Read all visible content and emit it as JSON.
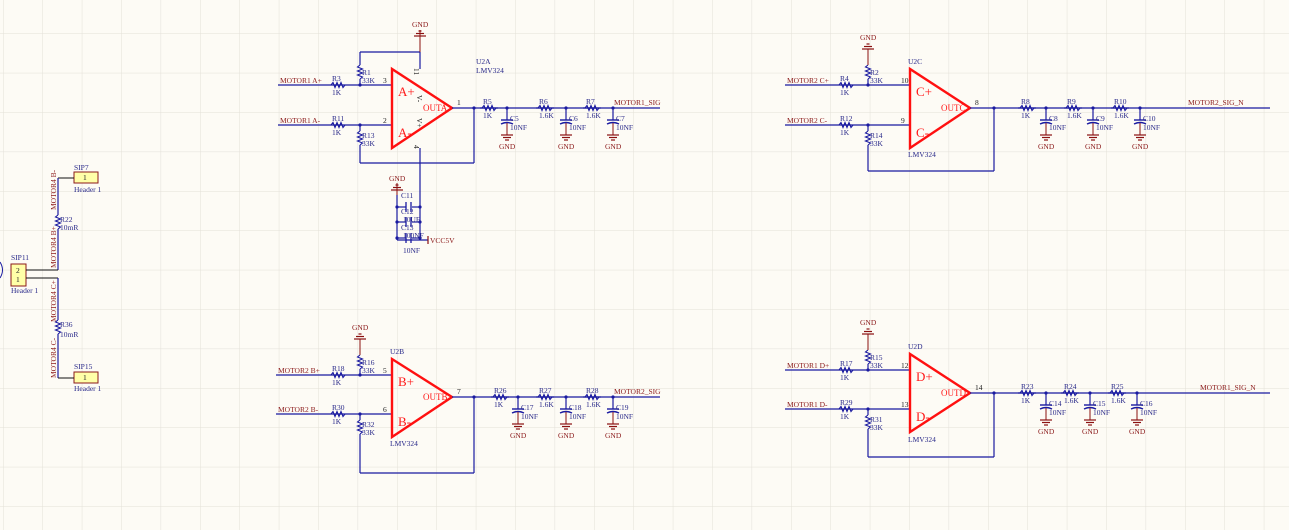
{
  "colors": {
    "wire": "#1a1aa0",
    "opamp": "#ff1010",
    "net_label": "#8b1a1a",
    "ref_text": "#2a2a8a",
    "ground": "#8b1010",
    "grid": "#e3e0d8",
    "background": "#fdfbf5",
    "header_fill": "#ffffa8"
  },
  "gnd_label": "GND",
  "blocks": [
    {
      "unit": "U2A",
      "part": "LMV324",
      "in_pos_net": "MOTOR1 A+",
      "in_neg_net": "MOTOR1 A-",
      "r_in_pos": {
        "ref": "R3",
        "value": "1K"
      },
      "r_bias": {
        "ref": "R1",
        "value": "33K"
      },
      "r_in_neg": {
        "ref": "R11",
        "value": "1K"
      },
      "r_fb": {
        "ref": "R13",
        "value": "33K"
      },
      "pin_pos": "3",
      "pin_neg": "2",
      "pin_out": "1",
      "sym_pos": "A+",
      "sym_neg": "A-",
      "sym_out": "OUTA",
      "filter": [
        {
          "r": "R5",
          "rv": "1K",
          "c": "C5",
          "cv": "10NF"
        },
        {
          "r": "R6",
          "rv": "1.6K",
          "c": "C6",
          "cv": "10NF"
        },
        {
          "r": "R7",
          "rv": "1.6K",
          "c": "C7",
          "cv": "10NF"
        }
      ],
      "output_net": "MOTOR1_SIG"
    },
    {
      "unit": "U2B",
      "part": "LMV324",
      "in_pos_net": "MOTOR2 B+",
      "in_neg_net": "MOTOR2 B-",
      "r_in_pos": {
        "ref": "R18",
        "value": "1K"
      },
      "r_bias": {
        "ref": "R16",
        "value": "33K"
      },
      "r_in_neg": {
        "ref": "R30",
        "value": "1K"
      },
      "r_fb": {
        "ref": "R32",
        "value": "33K"
      },
      "pin_pos": "5",
      "pin_neg": "6",
      "pin_out": "7",
      "sym_pos": "B+",
      "sym_neg": "B-",
      "sym_out": "OUTB",
      "filter": [
        {
          "r": "R26",
          "rv": "1K",
          "c": "C17",
          "cv": "10NF"
        },
        {
          "r": "R27",
          "rv": "1.6K",
          "c": "C18",
          "cv": "10NF"
        },
        {
          "r": "R28",
          "rv": "1.6K",
          "c": "C19",
          "cv": "10NF"
        }
      ],
      "output_net": "MOTOR2_SIG"
    },
    {
      "unit": "U2C",
      "part": "LMV324",
      "in_pos_net": "MOTOR2 C+",
      "in_neg_net": "MOTOR2 C-",
      "r_in_pos": {
        "ref": "R4",
        "value": "1K"
      },
      "r_bias": {
        "ref": "R2",
        "value": "33K"
      },
      "r_in_neg": {
        "ref": "R12",
        "value": "1K"
      },
      "r_fb": {
        "ref": "R14",
        "value": "33K"
      },
      "pin_pos": "10",
      "pin_neg": "9",
      "pin_out": "8",
      "sym_pos": "C+",
      "sym_neg": "C-",
      "sym_out": "OUTC",
      "filter": [
        {
          "r": "R8",
          "rv": "1K",
          "c": "C8",
          "cv": "10NF"
        },
        {
          "r": "R9",
          "rv": "1.6K",
          "c": "C9",
          "cv": "10NF"
        },
        {
          "r": "R10",
          "rv": "1.6K",
          "c": "C10",
          "cv": "10NF"
        }
      ],
      "output_net": "MOTOR2_SIG_N"
    },
    {
      "unit": "U2D",
      "part": "LMV324",
      "in_pos_net": "MOTOR1 D+",
      "in_neg_net": "MOTOR1 D-",
      "r_in_pos": {
        "ref": "R17",
        "value": "1K"
      },
      "r_bias": {
        "ref": "R15",
        "value": "33K"
      },
      "r_in_neg": {
        "ref": "R29",
        "value": "1K"
      },
      "r_fb": {
        "ref": "R31",
        "value": "33K"
      },
      "pin_pos": "12",
      "pin_neg": "13",
      "pin_out": "14",
      "sym_pos": "D+",
      "sym_neg": "D-",
      "sym_out": "OUTD",
      "filter": [
        {
          "r": "R23",
          "rv": "1K",
          "c": "C14",
          "cv": "10NF"
        },
        {
          "r": "R24",
          "rv": "1.6K",
          "c": "C15",
          "cv": "10NF"
        },
        {
          "r": "R25",
          "rv": "1.6K",
          "c": "C16",
          "cv": "10NF"
        }
      ],
      "output_net": "MOTOR1_SIG_N"
    }
  ],
  "power": {
    "pin_vminus": "V-",
    "pin_vminus_num": "11",
    "pin_vplus": "V+",
    "pin_vplus_num": "4",
    "caps": [
      {
        "ref": "C11",
        "value": "10UF"
      },
      {
        "ref": "C12",
        "value": "100NF"
      },
      {
        "ref": "C13",
        "value": "10NF"
      }
    ],
    "supply_net": "VCC5V"
  },
  "sense": {
    "main_header": {
      "ref": "SIP11",
      "type": "Header 1",
      "pins": [
        "2",
        "1"
      ]
    },
    "top_header": {
      "ref": "SIP7",
      "type": "Header 1",
      "pin": "1"
    },
    "bottom_header": {
      "ref": "SIP15",
      "type": "Header 1",
      "pin": "1"
    },
    "r_top": {
      "ref": "R22",
      "value": "10mR"
    },
    "r_bottom": {
      "ref": "R36",
      "value": "10mR"
    },
    "nets": [
      "MOTOR4 B-",
      "MOTOR4 B+",
      "MOTOR4 C+",
      "MOTOR4 C-"
    ]
  }
}
